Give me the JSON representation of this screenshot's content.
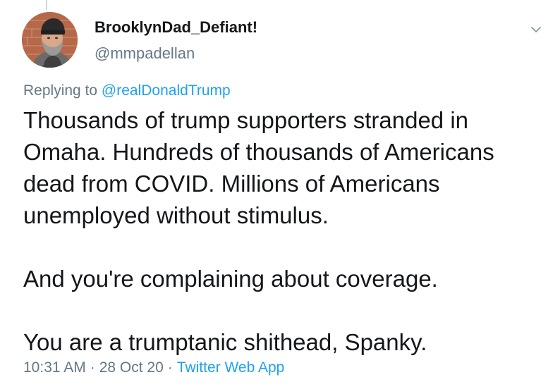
{
  "author": {
    "display_name": "BrooklynDad_Defiant!",
    "handle": "@mmpadellan"
  },
  "reply": {
    "prefix": "Replying to ",
    "target": "@realDonaldTrump"
  },
  "tweet": {
    "paragraphs": [
      "Thousands of trump supporters stranded in\nOmaha. Hundreds of thousands of Americans\ndead from COVID. Millions of Americans\nunemployed without stimulus.",
      "And you're complaining about coverage.",
      "You are a trumptanic shithead, Spanky."
    ]
  },
  "meta": {
    "time": "10:31 AM",
    "separator": "·",
    "date": "28 Oct 20",
    "source": "Twitter Web App"
  },
  "icons": {
    "menu": "chevron-down-icon",
    "avatar": "profile-photo"
  },
  "colors": {
    "link": "#1da1f2",
    "secondary_text": "#657786",
    "primary_text": "#14171a"
  }
}
